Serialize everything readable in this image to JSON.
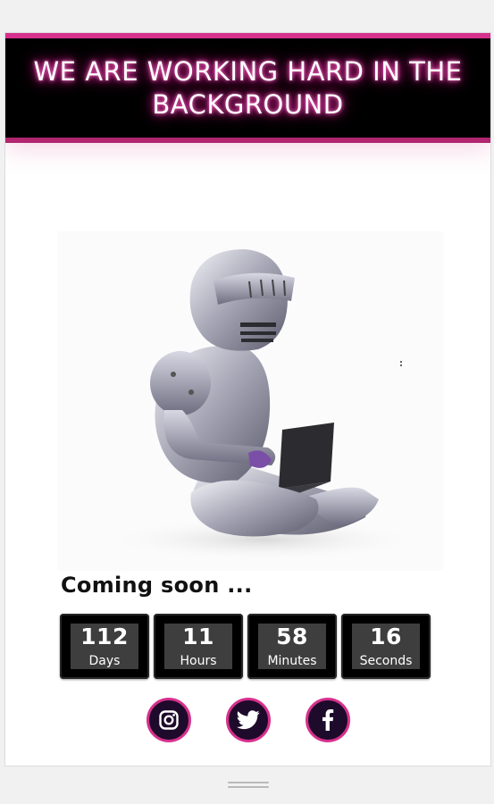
{
  "banner": {
    "title": "We are working hard in the background"
  },
  "hero": {
    "image": "knight-with-laptop"
  },
  "main": {
    "heading": "Coming soon ..."
  },
  "countdown": [
    {
      "value": "112",
      "label": "Days"
    },
    {
      "value": "11",
      "label": "Hours"
    },
    {
      "value": "58",
      "label": "Minutes"
    },
    {
      "value": "16",
      "label": "Seconds"
    }
  ],
  "social": [
    {
      "name": "instagram",
      "icon": "instagram-icon"
    },
    {
      "name": "twitter",
      "icon": "twitter-icon"
    },
    {
      "name": "facebook",
      "icon": "facebook-icon"
    }
  ],
  "colors": {
    "accent": "#d6318c",
    "banner_bg": "#000000",
    "social_bg": "#1e0a2a",
    "timer_bg": "#000000"
  }
}
